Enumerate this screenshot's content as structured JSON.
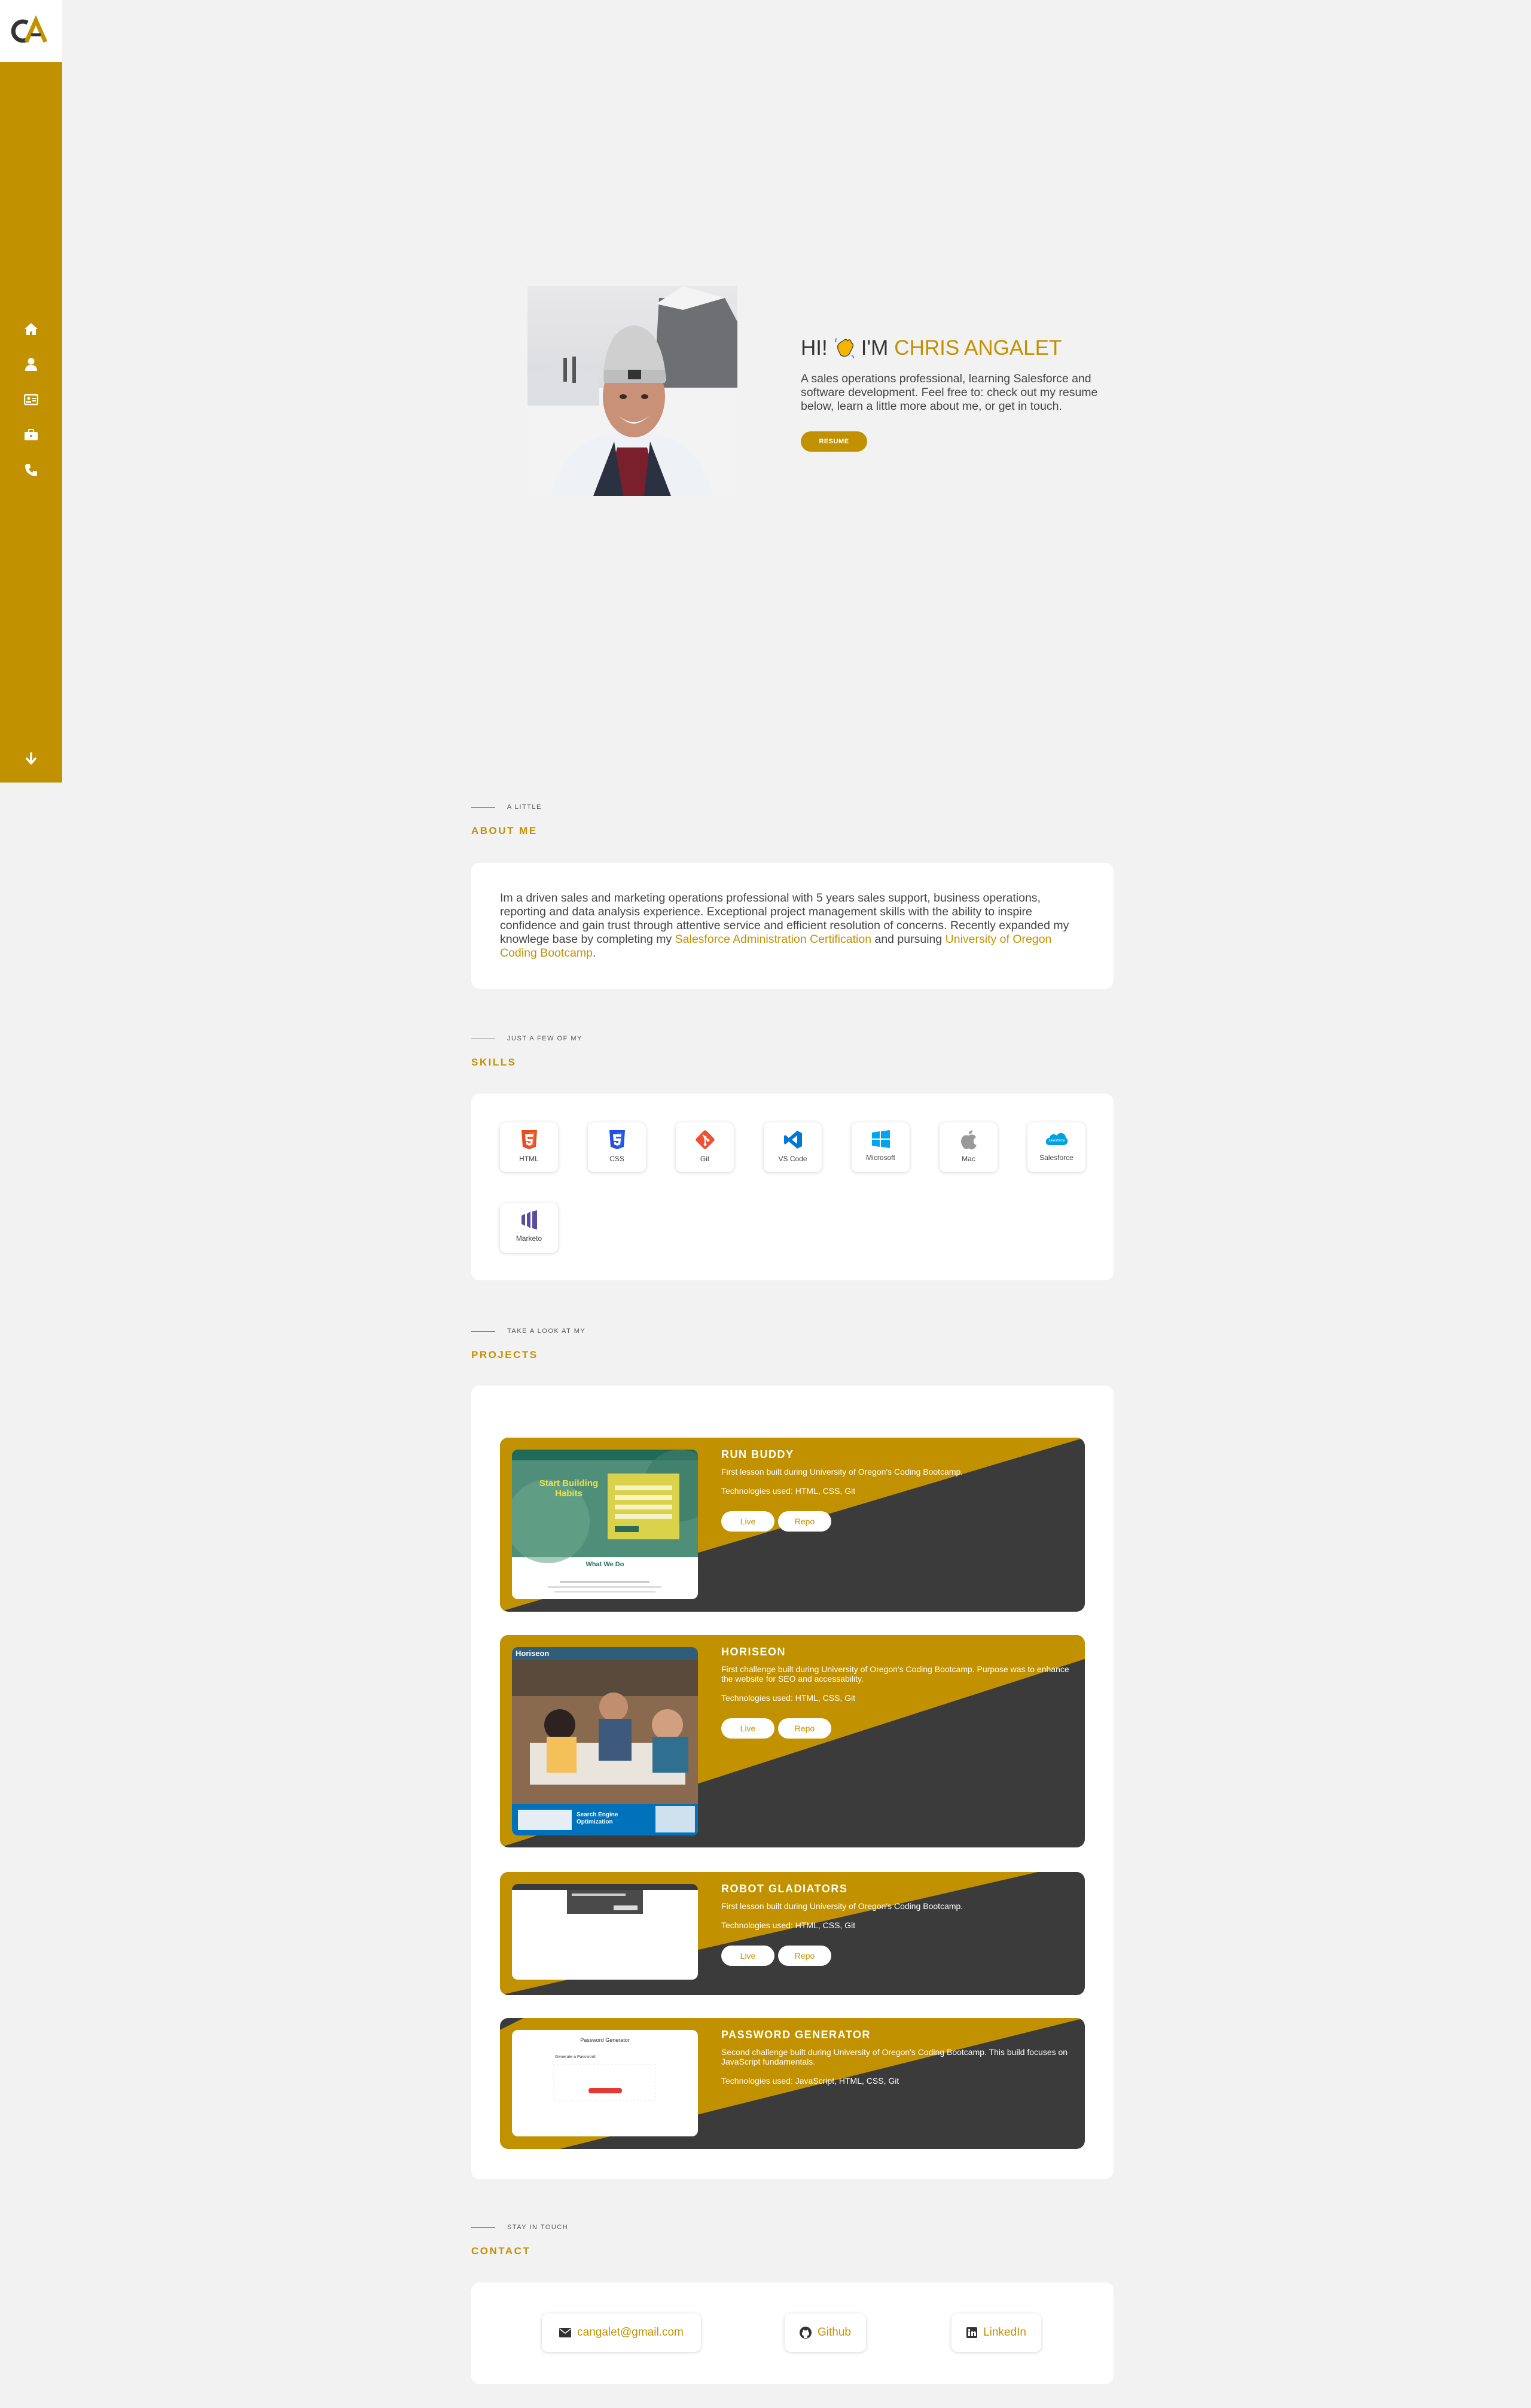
{
  "logo": {
    "text": "CA"
  },
  "nav": {
    "items": [
      "home-icon",
      "user-icon",
      "id-card-icon",
      "briefcase-icon",
      "phone-icon"
    ],
    "scroll_icon": "arrow-down-icon"
  },
  "hero": {
    "greeting": "HI!",
    "wave_icon": "waving-hand-icon",
    "im": "I'M",
    "name": "CHRIS ANGALET",
    "description": "A sales operations professional, learning Salesforce and software development. Feel free to: check out my resume below, learn a little more about me, or get in touch.",
    "resume_label": "RESUME"
  },
  "about": {
    "pre": "A LITTLE",
    "title": "ABOUT ME",
    "text_1": "Im a driven sales and marketing operations professional with 5 years sales support, business operations, reporting and data analysis experience. Exceptional project management skills with the ability to inspire confidence and gain trust through attentive service and efficient resolution of concerns. Recently expanded my knowlege base by completing my ",
    "link_1": "Salesforce Administration Certification",
    "text_2": " and pursuing ",
    "link_2": "University of Oregon Coding Bootcamp",
    "text_3": "."
  },
  "skills": {
    "pre": "JUST A FEW OF MY",
    "title": "SKILLS",
    "items": [
      {
        "label": "HTML",
        "icon": "html5-icon",
        "color": "#e44d26"
      },
      {
        "label": "CSS",
        "icon": "css3-icon",
        "color": "#264de4"
      },
      {
        "label": "Git",
        "icon": "git-icon",
        "color": "#f05032"
      },
      {
        "label": "VS Code",
        "icon": "vscode-icon",
        "color": "#0078d7"
      },
      {
        "label": "Microsoft",
        "icon": "windows-icon",
        "color": "#00a4ef"
      },
      {
        "label": "Mac",
        "icon": "apple-icon",
        "color": "#999999"
      },
      {
        "label": "Salesforce",
        "icon": "salesforce-icon",
        "color": "#00a1e0"
      },
      {
        "label": "Marketo",
        "icon": "marketo-icon",
        "color": "#5c4c9f"
      }
    ]
  },
  "projects": {
    "pre": "TAKE A LOOK AT MY",
    "title": "PROJECTS",
    "items": [
      {
        "title": "RUN BUDDY",
        "description": "First lesson built during University of Oregon's Coding Bootcamp.",
        "tech": "Technologies used: HTML, CSS, Git",
        "live": "Live",
        "repo": "Repo",
        "thumb_heading": "Start Building Habits",
        "thumb_sub": "What We Do"
      },
      {
        "title": "HORISEON",
        "description": "First challenge built during University of Oregon's Coding Bootcamp. Purpose was to enhance the website for SEO and accessability.",
        "tech": "Technologies used: HTML, CSS, Git",
        "live": "Live",
        "repo": "Repo",
        "thumb_brand": "Horiseon",
        "thumb_caption": "Search Engine Optimization"
      },
      {
        "title": "ROBOT GLADIATORS",
        "description": "First lesson built during University of Oregon's Coding Bootcamp.",
        "tech": "Technologies used: HTML, CSS, Git",
        "live": "Live",
        "repo": "Repo"
      },
      {
        "title": "PASSWORD GENERATOR",
        "description": "Second challenge built during University of Oregon's Coding Bootcamp. This build focuses on JavaScript fundamentals.",
        "tech": "Technologies used: JavaScript, HTML, CSS, Git",
        "thumb_title": "Password Generator",
        "thumb_sub": "Generate a Password"
      }
    ]
  },
  "contact": {
    "pre": "STAY IN TOUCH",
    "title": "CONTACT",
    "email": "cangalet@gmail.com",
    "github": "Github",
    "linkedin": "LinkedIn"
  },
  "colors": {
    "accent": "#c29100",
    "dark": "#3b3b3b",
    "background": "#f2f2f2"
  }
}
